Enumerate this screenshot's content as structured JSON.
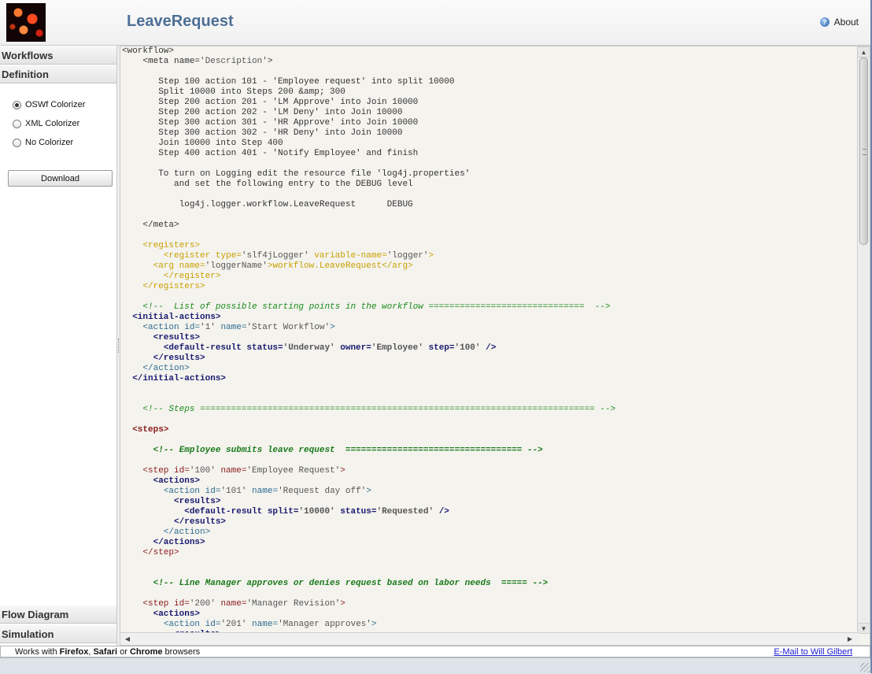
{
  "header": {
    "title": "LeaveRequest",
    "about_label": "About"
  },
  "sidebar": {
    "sections": [
      "Workflows",
      "Definition"
    ],
    "colorizer_options": [
      {
        "label": "OSWf Colorizer",
        "selected": true
      },
      {
        "label": "XML Colorizer",
        "selected": false
      },
      {
        "label": "No Colorizer",
        "selected": false
      }
    ],
    "download_label": "Download",
    "bottom_sections": [
      "Flow Diagram",
      "Simulation"
    ]
  },
  "code_lines": [
    "<workflow>",
    "    <meta name='Description'>",
    "",
    "       Step 100 action 101 - 'Employee request' into split 10000",
    "       Split 10000 into Steps 200 &amp; 300",
    "       Step 200 action 201 - 'LM Approve' into Join 10000",
    "       Step 200 action 202 - 'LM Deny' into Join 10000",
    "       Step 300 action 301 - 'HR Approve' into Join 10000",
    "       Step 300 action 302 - 'HR Deny' into Join 10000",
    "       Join 10000 into Step 400",
    "       Step 400 action 401 - 'Notify Employee' and finish",
    "",
    "       To turn on Logging edit the resource file 'log4j.properties'",
    "          and set the following entry to the DEBUG level",
    "",
    "           log4j.logger.workflow.LeaveRequest      DEBUG",
    "",
    "    </meta>",
    "",
    "    <registers>",
    "        <register type='slf4jLogger' variable-name='logger'>",
    "      <arg name='loggerName'>workflow.LeaveRequest</arg>",
    "        </register>",
    "    </registers>",
    "",
    "    <!--  List of possible starting points in the workflow ==============================  -->",
    "  <initial-actions>",
    "    <action id='1' name='Start Workflow'>",
    "      <results>",
    "        <default-result status='Underway' owner='Employee' step='100' />",
    "      </results>",
    "    </action>",
    "  </initial-actions>",
    "",
    "",
    "    <!-- Steps ============================================================================ -->",
    "",
    "  <steps>",
    "",
    "      <!-- Employee submits leave request  ================================== -->",
    "",
    "    <step id='100' name='Employee Request'>",
    "      <actions>",
    "        <action id='101' name='Request day off'>",
    "          <results>",
    "            <default-result split='10000' status='Requested' />",
    "          </results>",
    "        </action>",
    "      </actions>",
    "    </step>",
    "",
    "",
    "      <!-- Line Manager approves or denies request based on labor needs  ===== -->",
    "",
    "    <step id='200' name='Manager Revision'>",
    "      <actions>",
    "        <action id='201' name='Manager approves'>",
    "          <results>"
  ],
  "footer": {
    "prefix": "Works with ",
    "firefox": "Firefox",
    "sep1": ", ",
    "safari": "Safari",
    "sep2": " or ",
    "chrome": "Chrome",
    "suffix": " browsers",
    "email_link": "E-Mail to Will Gilbert"
  }
}
